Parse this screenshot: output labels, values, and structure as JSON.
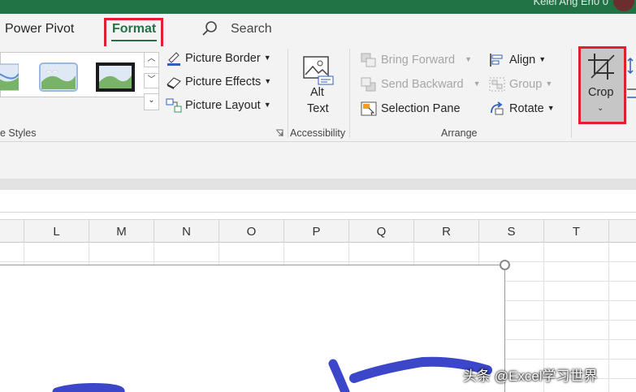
{
  "titlebar": {
    "user_name": "Kelei Ang Eh0 0"
  },
  "tabs": {
    "power_pivot": "Power Pivot",
    "format": "Format",
    "search": "Search"
  },
  "ribbon": {
    "picture_border": "Picture Border",
    "picture_effects": "Picture Effects",
    "picture_layout": "Picture Layout",
    "styles_group": "e Styles",
    "alt_text_line1": "Alt",
    "alt_text_line2": "Text",
    "accessibility_group": "Accessibility",
    "bring_forward": "Bring Forward",
    "send_backward": "Send Backward",
    "selection_pane": "Selection Pane",
    "align": "Align",
    "group": "Group",
    "rotate": "Rotate",
    "arrange_group": "Arrange",
    "crop": "Crop"
  },
  "columns": [
    "L",
    "M",
    "N",
    "O",
    "P",
    "Q",
    "R",
    "S",
    "T"
  ],
  "watermark": "头条 @Excel学习世界",
  "colors": {
    "excel_green": "#217346",
    "highlight_red": "#e0202a",
    "ink_blue": "#3b46c8"
  }
}
